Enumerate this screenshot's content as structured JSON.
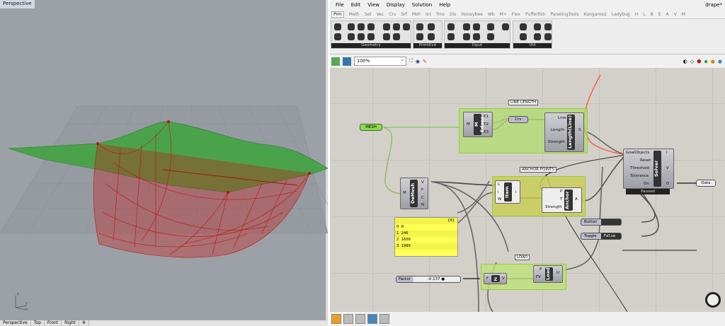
{
  "rhino": {
    "viewport_label": "Perspective",
    "viewport_tabs": [
      "Perspective",
      "Top",
      "Front",
      "Right"
    ],
    "axes": {
      "x": "x",
      "y": "y",
      "z": "z"
    }
  },
  "gh": {
    "menu": [
      "File",
      "Edit",
      "View",
      "Display",
      "Solution",
      "Help"
    ],
    "doc_title": "drape*",
    "tabs": [
      "Prm",
      "Math",
      "Set",
      "Vec",
      "Crv",
      "Srf",
      "Msh",
      "Int",
      "Trns",
      "Dis",
      "Honeybee",
      "Wb",
      "M+",
      "Flex",
      "Pufferfish",
      "PanelingTools",
      "Kangaroo2",
      "Ladybug",
      "H",
      "L",
      "B",
      "E",
      "A",
      "V",
      "M"
    ],
    "ribbon_panels": [
      "Geometry",
      "Primitive",
      "Input",
      "Util"
    ],
    "zoom": "100%",
    "groups": {
      "line_length": "LINE LENGTH",
      "anchor_points": "ANCHOR POINTS",
      "load": "LOAD"
    },
    "nodes": {
      "mesh": "MESH",
      "medges": {
        "name": "M Edges",
        "inputs": [
          "M"
        ],
        "outputs": [
          "E1",
          "E2",
          "E3"
        ]
      },
      "crv": "Crv",
      "length": {
        "name": "Length(Line)",
        "inputs": [
          "Line",
          "Length",
          "Strength"
        ],
        "outputs": [
          "S"
        ]
      },
      "solver": {
        "name": "Solver",
        "inputs": [
          "GoalObjects",
          "Reset",
          "Threshold",
          "Tolerance",
          "On"
        ],
        "outputs": [
          "I",
          "V",
          "O"
        ],
        "status": "Paused"
      },
      "data": "Data",
      "demesh": {
        "name": "DeMesh",
        "inputs": [
          "M"
        ],
        "outputs": [
          "V",
          "F",
          "C",
          "N"
        ]
      },
      "item": {
        "name": "Item",
        "inputs": [
          "L",
          "i",
          "W"
        ],
        "outputs": [
          "i"
        ]
      },
      "anchor": {
        "name": "Anchor",
        "inputs": [
          "P",
          "T",
          "Strength"
        ],
        "outputs": [
          "A"
        ]
      },
      "button": "Button",
      "toggle": {
        "label": "Toggle",
        "value": "False"
      },
      "factor": {
        "label": "Factor",
        "value": "-0.137"
      },
      "unitz": {
        "name": "Z",
        "inputs": [
          "F"
        ],
        "outputs": [
          "V"
        ]
      },
      "load": {
        "name": "Load",
        "inputs": [
          "P",
          "FV"
        ],
        "outputs": [
          "U"
        ]
      }
    },
    "panel": {
      "header": "{0}",
      "rows": [
        {
          "i": "0",
          "v": "0"
        },
        {
          "i": "1",
          "v": "246"
        },
        {
          "i": "2",
          "v": "1600"
        },
        {
          "i": "3",
          "v": "1989"
        }
      ]
    }
  }
}
